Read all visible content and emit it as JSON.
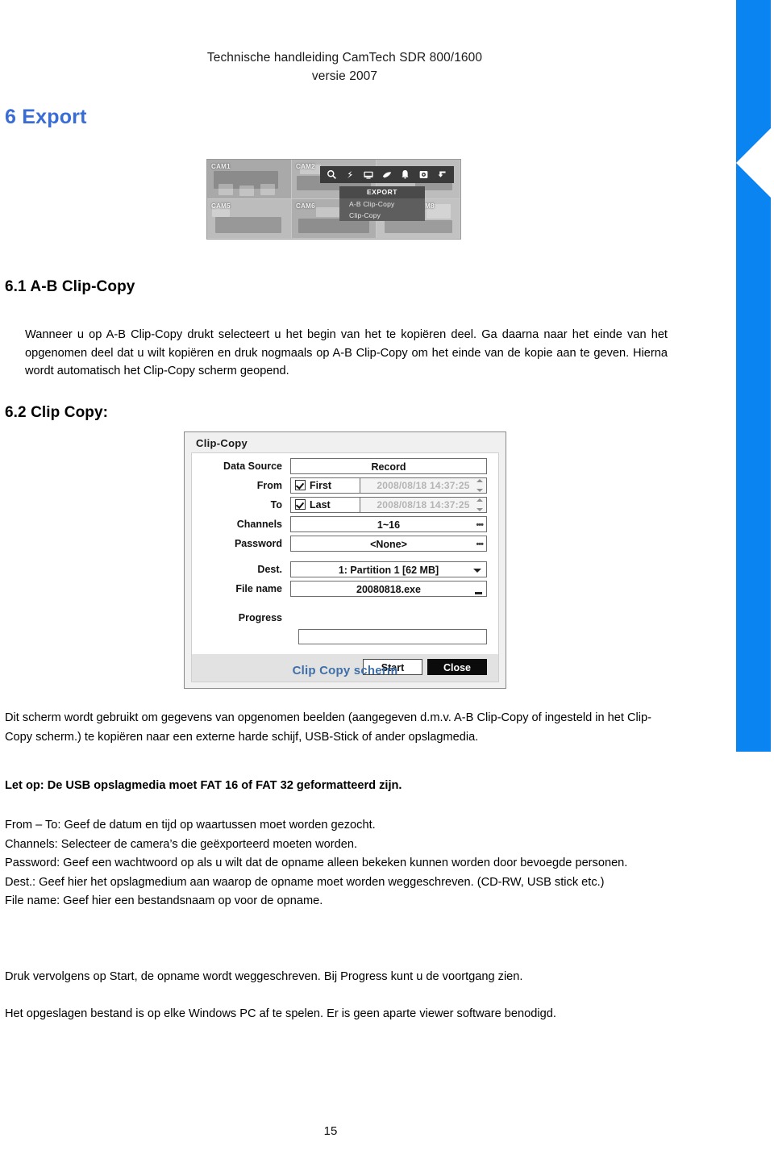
{
  "header": {
    "line1": "Technische handleiding CamTech SDR 800/1600",
    "line2": "versie 2007"
  },
  "titles": {
    "chapter": "6 Export",
    "section_61": "6.1 A-B Clip-Copy",
    "section_62": "6.2 Clip Copy:"
  },
  "intro_paragraph": "Wanneer u op A-B Clip-Copy drukt selecteert u het begin van het te kopiëren deel. Ga daarna naar het einde van het opgenomen deel dat u wilt kopiëren en druk nogmaals op A-B Clip-Copy om het einde van de kopie aan te geven. Hierna wordt automatisch het Clip-Copy scherm geopend.",
  "dvr_screenshot": {
    "cameras": [
      "CAM1",
      "CAM2",
      "CAM5",
      "CAM6",
      "CAM8"
    ],
    "toolbar_icons": [
      "search-icon",
      "playback-icon",
      "monitor-icon",
      "ptz-hand-icon",
      "alarm-bell-icon",
      "record-icon",
      "back-arrow-icon"
    ],
    "menu": {
      "title": "EXPORT",
      "items": [
        "A-B Clip-Copy",
        "Clip-Copy"
      ]
    }
  },
  "clip_dialog": {
    "title": "Clip-Copy",
    "rows": {
      "data_source_label": "Data Source",
      "data_source_value": "Record",
      "from_label": "From",
      "from_check_label": "First",
      "from_datetime": "2008/08/18  14:37:25",
      "to_label": "To",
      "to_check_label": "Last",
      "to_datetime": "2008/08/18  14:37:25",
      "channels_label": "Channels",
      "channels_value": "1~16",
      "password_label": "Password",
      "password_value": "<None>",
      "dest_label": "Dest.",
      "dest_value": "1: Partition 1 [62 MB]",
      "filename_label": "File name",
      "filename_value": "20080818.exe",
      "progress_label": "Progress"
    },
    "buttons": {
      "start": "Start",
      "close": "Close"
    }
  },
  "caption": "Clip Copy scherm",
  "paragraphs": {
    "usage": "Dit scherm wordt gebruikt om gegevens van opgenomen beelden (aangegeven d.m.v. A-B Clip-Copy of ingesteld in het Clip-Copy scherm.) te kopiëren naar een externe harde schijf, USB-Stick of ander opslagmedia.",
    "note": "Let op: De USB opslagmedia moet  FAT 16 of FAT 32 geformatteerd zijn.",
    "field_from_to": "From – To: Geef de datum en tijd op waartussen moet worden gezocht.",
    "field_channels": "Channels: Selecteer de camera’s die geëxporteerd moeten worden.",
    "field_password": "Password: Geef een wachtwoord op als u wilt dat de opname alleen bekeken kunnen worden door bevoegde personen.",
    "field_dest": "Dest.: Geef hier het opslagmedium aan waarop de opname moet worden weggeschreven. (CD-RW, USB stick etc.)",
    "field_filename": "File name: Geef hier een bestandsnaam op voor de opname.",
    "start": "Druk vervolgens op Start, de opname wordt weggeschreven. Bij Progress kunt u de voortgang zien.",
    "player": "Het opgeslagen bestand is op elke Windows PC af te spelen. Er is geen aparte viewer software benodigd."
  },
  "page_number": "15",
  "colors": {
    "chapter_blue": "#3a6cd6",
    "caption_blue": "#3f6fa8",
    "bar_blue": "#0a84f0"
  }
}
